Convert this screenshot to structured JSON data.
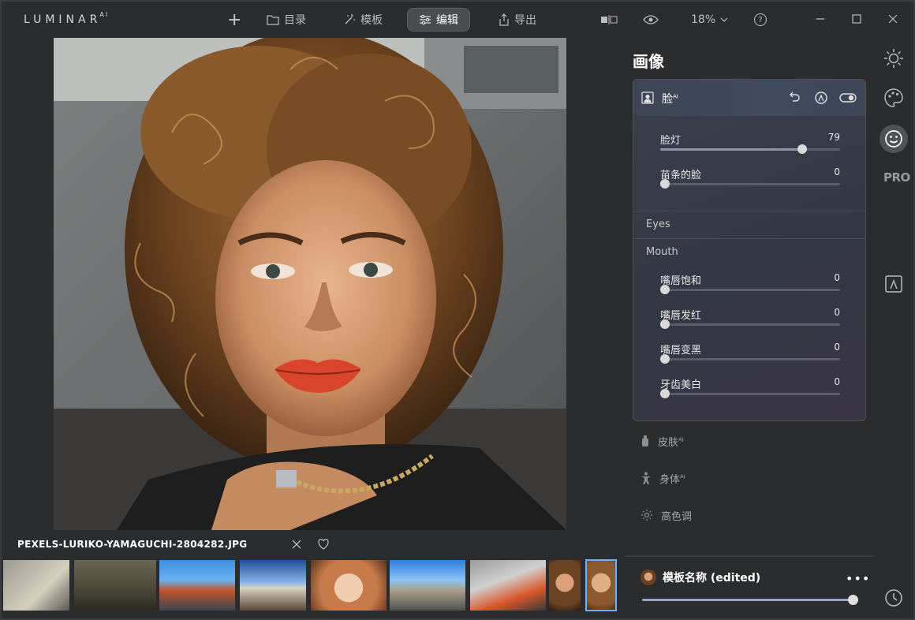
{
  "app": {
    "logo": "LUMINAR",
    "logo_suffix": "AI"
  },
  "toolbar": {
    "add": "+",
    "catalog": "目录",
    "templates": "模板",
    "edit": "编辑",
    "export": "导出",
    "zoom": "18%",
    "help": "?"
  },
  "file": {
    "name": "PEXELS-LURIKO-YAMAGUCHI-2804282.JPG"
  },
  "panel": {
    "title": "画像",
    "face": {
      "title": "脸",
      "title_suffix": "AI",
      "sliders": [
        {
          "label": "脸灯",
          "value": 79,
          "fraction": 0.79
        },
        {
          "label": "苗条的脸",
          "value": 0,
          "fraction": 0.0
        }
      ]
    },
    "eyes_label": "Eyes",
    "mouth": {
      "label": "Mouth",
      "sliders": [
        {
          "label": "嘴唇饱和",
          "value": 0,
          "fraction": 0.0
        },
        {
          "label": "嘴唇发红",
          "value": 0,
          "fraction": 0.0
        },
        {
          "label": "嘴唇变黑",
          "value": 0,
          "fraction": 0.0
        },
        {
          "label": "牙齿美白",
          "value": 0,
          "fraction": 0.0
        }
      ]
    },
    "tools": [
      {
        "label": "皮肤",
        "suffix": "AI"
      },
      {
        "label": "身体",
        "suffix": "AI"
      },
      {
        "label": "高色调",
        "suffix": ""
      }
    ],
    "preset": {
      "name": "模板名称 (edited)",
      "more": "•••",
      "amount": 1.0
    }
  },
  "rail": {
    "pro": "PRO"
  },
  "colors": {
    "accent": "#6fb0ff",
    "background": "#2b2c2e",
    "card": "#373b47",
    "lip": "#d8452c"
  }
}
